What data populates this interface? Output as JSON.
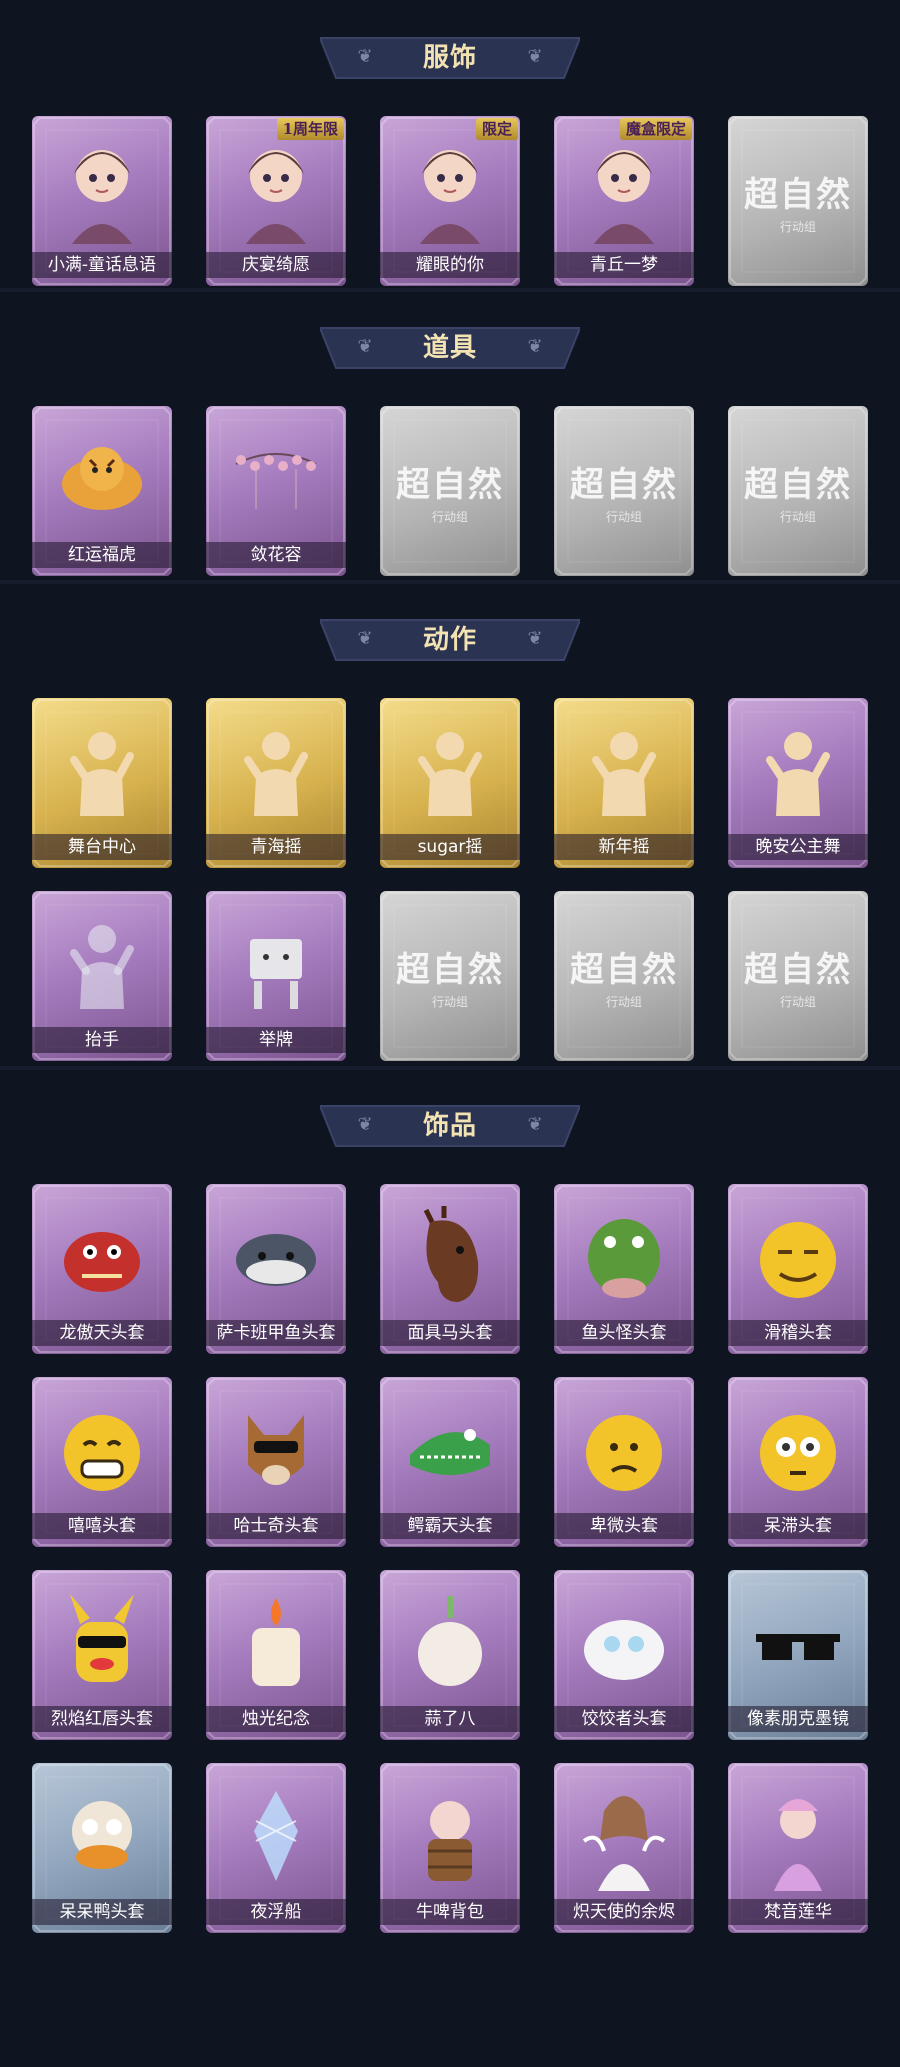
{
  "sections": [
    {
      "title": "服饰",
      "items": [
        {
          "label": "小满-童话息语",
          "style": "purple",
          "art": "character"
        },
        {
          "label": "庆宴绮愿",
          "style": "purple",
          "art": "character",
          "badge": "1周年限"
        },
        {
          "label": "耀眼的你",
          "style": "purple",
          "art": "character",
          "badge": "限定"
        },
        {
          "label": "青丘一梦",
          "style": "purple",
          "art": "character",
          "badge": "魔盒限定"
        },
        {
          "label": "",
          "style": "grey",
          "art": "placeholder"
        }
      ]
    },
    {
      "title": "道具",
      "items": [
        {
          "label": "红运福虎",
          "style": "purple",
          "art": "tiger"
        },
        {
          "label": "敛花容",
          "style": "purple",
          "art": "flowers"
        },
        {
          "label": "",
          "style": "grey",
          "art": "placeholder"
        },
        {
          "label": "",
          "style": "grey",
          "art": "placeholder"
        },
        {
          "label": "",
          "style": "grey",
          "art": "placeholder"
        }
      ]
    },
    {
      "title": "动作",
      "items": [
        {
          "label": "舞台中心",
          "style": "gold",
          "art": "pose"
        },
        {
          "label": "青海摇",
          "style": "gold",
          "art": "pose"
        },
        {
          "label": "sugar摇",
          "style": "gold",
          "art": "pose"
        },
        {
          "label": "新年摇",
          "style": "gold",
          "art": "pose"
        },
        {
          "label": "晚安公主舞",
          "style": "purple",
          "art": "pose"
        },
        {
          "label": "抬手",
          "style": "purple",
          "art": "pose-ghost"
        },
        {
          "label": "举牌",
          "style": "purple",
          "art": "sign"
        },
        {
          "label": "",
          "style": "grey",
          "art": "placeholder"
        },
        {
          "label": "",
          "style": "grey",
          "art": "placeholder"
        },
        {
          "label": "",
          "style": "grey",
          "art": "placeholder"
        }
      ]
    },
    {
      "title": "饰品",
      "items": [
        {
          "label": "龙傲天头套",
          "style": "purple",
          "art": "dragon"
        },
        {
          "label": "萨卡班甲鱼头套",
          "style": "purple",
          "art": "fish"
        },
        {
          "label": "面具马头套",
          "style": "purple",
          "art": "horse"
        },
        {
          "label": "鱼头怪头套",
          "style": "purple",
          "art": "greenfish"
        },
        {
          "label": "滑稽头套",
          "style": "purple",
          "art": "emoji-smirk"
        },
        {
          "label": "嘻嘻头套",
          "style": "purple",
          "art": "emoji-grin"
        },
        {
          "label": "哈士奇头套",
          "style": "purple",
          "art": "dog"
        },
        {
          "label": "鳄霸天头套",
          "style": "purple",
          "art": "croc"
        },
        {
          "label": "卑微头套",
          "style": "purple",
          "art": "emoji-sad"
        },
        {
          "label": "呆滞头套",
          "style": "purple",
          "art": "emoji-stare"
        },
        {
          "label": "烈焰红唇头套",
          "style": "purple",
          "art": "pika"
        },
        {
          "label": "烛光纪念",
          "style": "purple",
          "art": "candle"
        },
        {
          "label": "蒜了八",
          "style": "purple",
          "art": "garlic"
        },
        {
          "label": "饺饺者头套",
          "style": "purple",
          "art": "dumpling"
        },
        {
          "label": "像素朋克墨镜",
          "style": "blue",
          "art": "glasses"
        },
        {
          "label": "呆呆鸭头套",
          "style": "blue",
          "art": "duck"
        },
        {
          "label": "夜浮船",
          "style": "purple",
          "art": "crystal"
        },
        {
          "label": "牛啤背包",
          "style": "purple",
          "art": "cow"
        },
        {
          "label": "炽天使的余烬",
          "style": "purple",
          "art": "angel"
        },
        {
          "label": "梵音莲华",
          "style": "purple",
          "art": "lotus"
        }
      ]
    }
  ],
  "placeholder": {
    "main": "超自然",
    "sub": "行动组"
  }
}
